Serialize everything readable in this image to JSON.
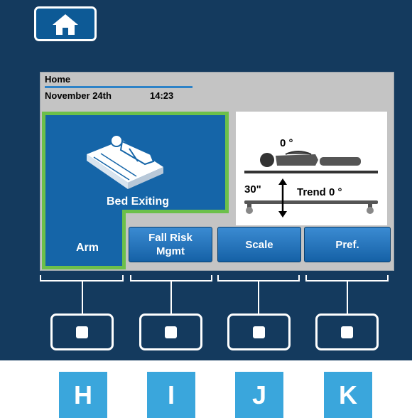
{
  "header": {
    "title": "Home",
    "date": "November 24th",
    "time": "14:23"
  },
  "bed_tile": {
    "label": "Bed Exiting",
    "arm_label": "Arm"
  },
  "trend": {
    "angle": "0 °",
    "time_window": "30\"",
    "trend_label": "Trend 0 °"
  },
  "soft_buttons": [
    {
      "label": "Fall Risk\nMgmt"
    },
    {
      "label": "Scale"
    },
    {
      "label": "Pref."
    }
  ],
  "keys": [
    "H",
    "I",
    "J",
    "K"
  ],
  "colors": {
    "panel": "#143a5e",
    "screen": "#c4c4c4",
    "tile": "#1565a8",
    "armed_border": "#6cc04a",
    "key": "#3aa6dc"
  },
  "icons": {
    "home": "home-icon",
    "bed": "bed-patient-icon",
    "trend": "patient-angle-icon"
  }
}
